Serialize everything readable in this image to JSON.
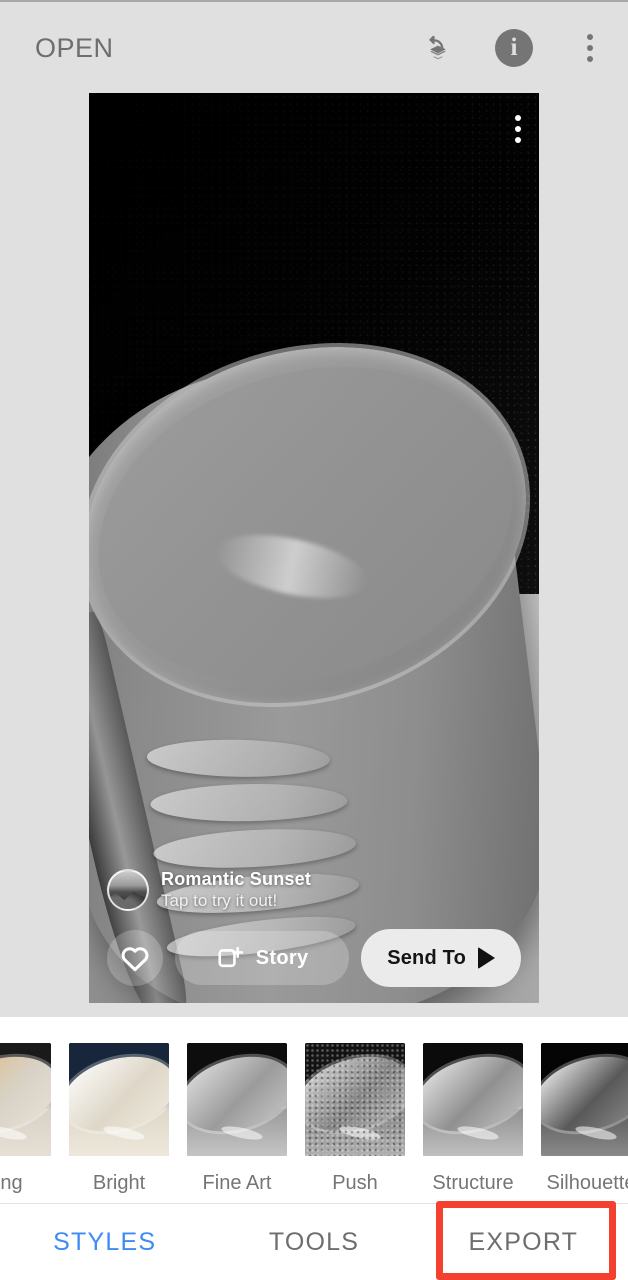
{
  "app": {
    "title": "OPEN"
  },
  "appbar": {
    "title": "OPEN",
    "actions": [
      {
        "name": "revert-stack-icon",
        "label": "Revert"
      },
      {
        "name": "info-icon",
        "label": "Info",
        "glyph": "i"
      },
      {
        "name": "overflow-menu-icon",
        "label": "More options"
      }
    ]
  },
  "photo": {
    "overflow_menu": "More",
    "overlay": {
      "lens_title": "Romantic Sunset",
      "lens_subtitle": "Tap to try it out!",
      "avatar_name": "lens-creator-avatar",
      "buttons": {
        "favorite": "",
        "story": "Story",
        "send_to": "Send To"
      }
    }
  },
  "styles_strip": {
    "items": [
      {
        "label": "...ing",
        "full_label": "Morning",
        "top": "#1a1a1a",
        "rim": "#d8d2c6",
        "base": "#e8e2d6",
        "accent": "#e0b77e",
        "grain": false
      },
      {
        "label": "Bright",
        "top": "#17263a",
        "rim": "#ded7c8",
        "base": "#efeade",
        "accent": "#ffffff",
        "grain": false
      },
      {
        "label": "Fine Art",
        "top": "#0d0d0d",
        "rim": "#9b9b9b",
        "base": "#c9c9c9",
        "accent": "#e5e5e5",
        "grain": false
      },
      {
        "label": "Push",
        "top": "#141414",
        "rim": "#868686",
        "base": "#b5b5b5",
        "accent": "#dcdcdc",
        "grain": true
      },
      {
        "label": "Structure",
        "top": "#0b0b0b",
        "rim": "#909090",
        "base": "#c4c4c4",
        "accent": "#ededed",
        "grain": false
      },
      {
        "label": "Silhouette",
        "top": "#050505",
        "rim": "#595959",
        "base": "#8f8f8f",
        "accent": "#ffffff",
        "grain": false
      }
    ]
  },
  "tabbar": {
    "tabs": [
      {
        "label": "STYLES",
        "active": true
      },
      {
        "label": "TOOLS",
        "active": false
      },
      {
        "label": "EXPORT",
        "active": false
      }
    ]
  },
  "annotation": {
    "target": "EXPORT",
    "color": "#f4402e"
  }
}
